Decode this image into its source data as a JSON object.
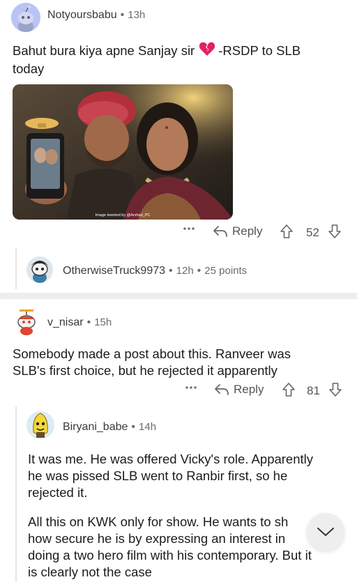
{
  "comments": [
    {
      "username": "Notyoursbabu",
      "time": "13h",
      "text_line1": "Bahut bura kiya apne Sanjay sir",
      "emoji_icon": "broken-heart",
      "text_after_emoji": "-RSDP to SLB",
      "text_line2": "today",
      "image_credit": "Image tweeted by @Arshad_PC",
      "reply_label": "Reply",
      "votes": "52"
    },
    {
      "username": "OtherwiseTruck9973",
      "time": "12h",
      "points": "25 points"
    },
    {
      "username": "v_nisar",
      "time": "15h",
      "text_line1": "Somebody made a post about this. Ranveer was",
      "text_line2": "SLB's first choice, but he rejected it apparently",
      "reply_label": "Reply",
      "votes": "81"
    },
    {
      "username": "Biryani_babe",
      "time": "14h",
      "para1": [
        "It was me. He was offered Vicky's role. Apparently",
        "he was pissed SLB went to Ranbir first, so he",
        "rejected it."
      ],
      "para2": [
        "All this on KWK only for show. He wants to sh",
        "how secure he is by expressing an interest in",
        "doing a two hero film with his contemporary. But it",
        "is clearly not the case"
      ]
    }
  ],
  "colors": {
    "broken_heart": "#e0245e",
    "divider": "#ededed"
  }
}
